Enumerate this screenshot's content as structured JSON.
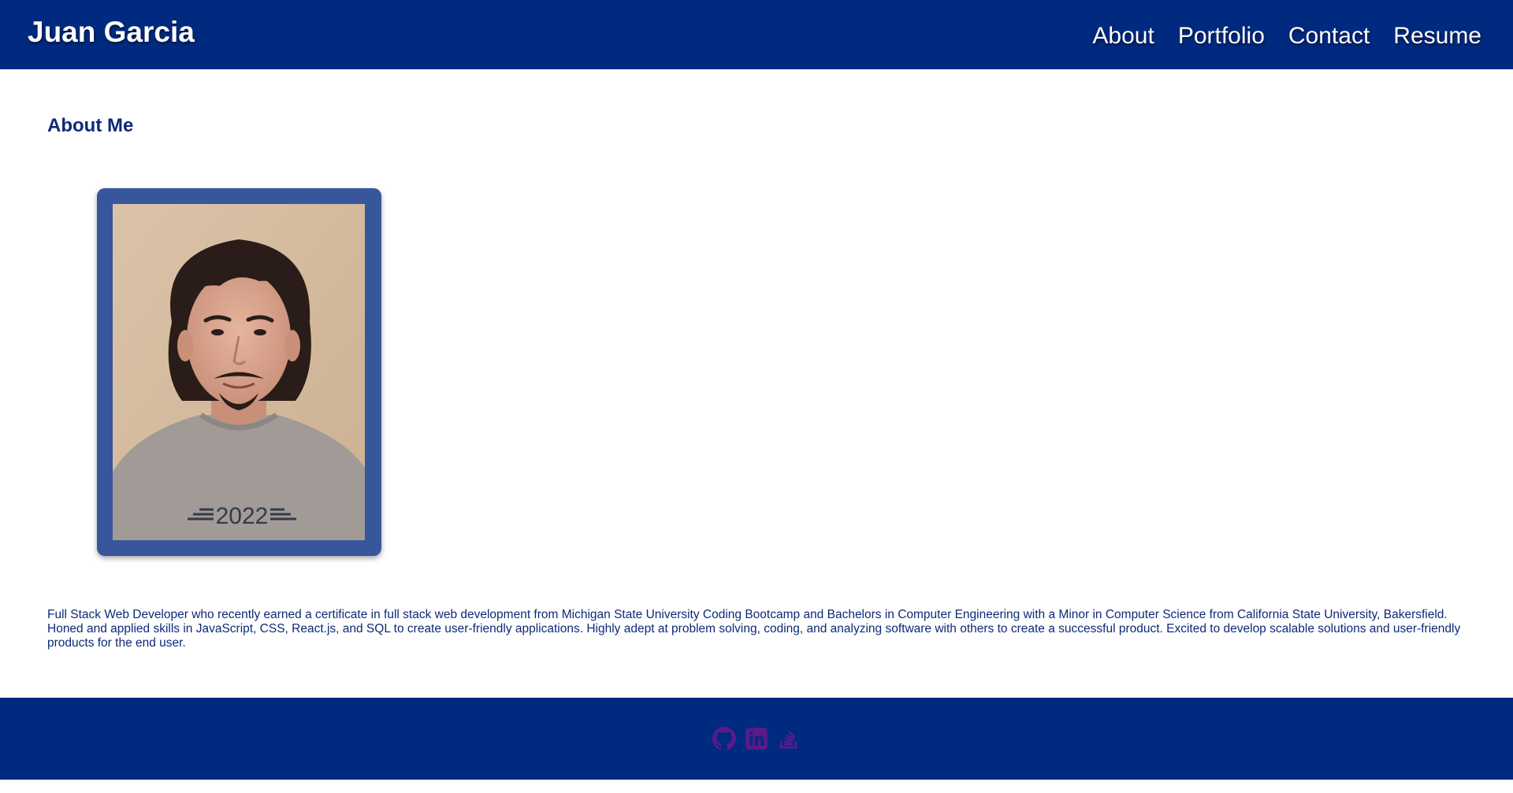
{
  "header": {
    "brand": "Juan Garcia",
    "nav": [
      {
        "label": "About"
      },
      {
        "label": "Portfolio"
      },
      {
        "label": "Contact"
      },
      {
        "label": "Resume"
      }
    ]
  },
  "about": {
    "title": "About Me",
    "photo_caption": "2022",
    "description": "Full Stack Web Developer who recently earned a certificate in full stack web development from Michigan State University Coding Bootcamp and Bachelors in Computer Engineering with a Minor in Computer Science from California State University, Bakersfield. Honed and applied skills in JavaScript, CSS, React.js, and SQL to create user-friendly applications. Highly adept at problem solving, coding, and analyzing software with others to create a successful product. Excited to develop scalable solutions and user-friendly products for the end user."
  },
  "footer": {
    "social_icons": [
      "github-icon",
      "linkedin-icon",
      "stackoverflow-icon"
    ]
  },
  "colors": {
    "header_bg": "#002a80",
    "accent_text": "#0d2a78",
    "photo_frame": "#37569b",
    "social_icon": "#5b1a8a"
  }
}
